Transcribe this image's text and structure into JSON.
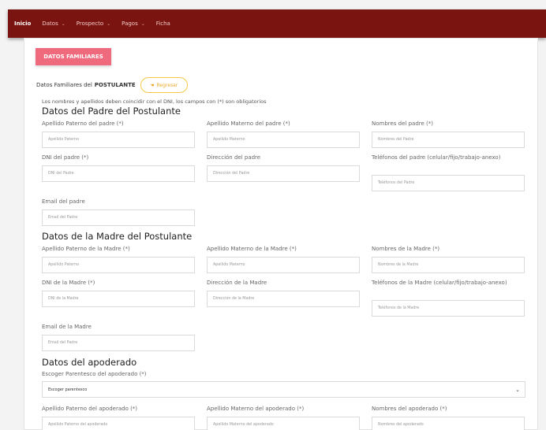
{
  "nav": {
    "items": [
      {
        "label": "Inicio",
        "active": true,
        "has_dropdown": false
      },
      {
        "label": "Datos",
        "active": false,
        "has_dropdown": true
      },
      {
        "label": "Prospecto",
        "active": false,
        "has_dropdown": true
      },
      {
        "label": "Pagos",
        "active": false,
        "has_dropdown": true
      },
      {
        "label": "Ficha",
        "active": false,
        "has_dropdown": false
      }
    ],
    "chevron_icon": "chevron-down-icon"
  },
  "tab_button": "DATOS FAMILIARES",
  "section": {
    "prefix": "Datos Familiares del",
    "bold": "POSTULANTE",
    "back_label": "Regresar",
    "back_icon": "hand-pointing-left-icon"
  },
  "note": "Los nombres y apellidos deben coincidir con el DNI, los campos con (*) son obligatorios",
  "padre": {
    "title": "Datos del Padre del Postulante",
    "fields": [
      {
        "label": "Apellido Paterno del padre (*)",
        "placeholder": "Apellido Paterno"
      },
      {
        "label": "Apellido Materno del padre (*)",
        "placeholder": "Apellido Materno"
      },
      {
        "label": "Nombres del padre (*)",
        "placeholder": "Nombres del Padre"
      },
      {
        "label": "DNI del padre (*)",
        "placeholder": "DNI del Padre"
      },
      {
        "label": "Dirección del padre",
        "placeholder": "Dirección del Padre"
      },
      {
        "label": "Teléfonos del padre (celular/fijo/trabajo-anexo)",
        "placeholder": "Teléfonos del Padre"
      },
      {
        "label": "Email del padre",
        "placeholder": "Email del Padre"
      }
    ]
  },
  "madre": {
    "title": "Datos de la Madre del Postulante",
    "fields": [
      {
        "label": "Apellido Paterno de la Madre (*)",
        "placeholder": "Apellido Paterno"
      },
      {
        "label": "Apellido Materno de la Madre (*)",
        "placeholder": "Apellido Materno"
      },
      {
        "label": "Nombres de la Madre (*)",
        "placeholder": "Nombres de la Madre"
      },
      {
        "label": "DNI de la Madre (*)",
        "placeholder": "DNI de la Madre"
      },
      {
        "label": "Dirección de la Madre",
        "placeholder": "Dirección de la Madre"
      },
      {
        "label": "Teléfonos de la Madre (celular/fijo/trabajo-anexo)",
        "placeholder": "Teléfonos de la Madre"
      },
      {
        "label": "Email de la Madre",
        "placeholder": "Email del Padre"
      }
    ]
  },
  "apoderado": {
    "title": "Datos del apoderado",
    "select_label": "Escoger Parentesco del apoderado (*)",
    "select_value": "Escoger parentesco",
    "fields": [
      {
        "label": "Apellido Paterno del apoderado (*)",
        "placeholder": "Apellido Paterno del apoderado"
      },
      {
        "label": "Apellido Materno del apoderado (*)",
        "placeholder": "Apellido Materno del apoderado"
      },
      {
        "label": "Nombres del apoderado (*)",
        "placeholder": "Nombres del apoderado"
      }
    ]
  },
  "colors": {
    "navbar": "#7a1410",
    "tab_button": "#ef6a7d",
    "regresar_border": "#f3c84a"
  }
}
